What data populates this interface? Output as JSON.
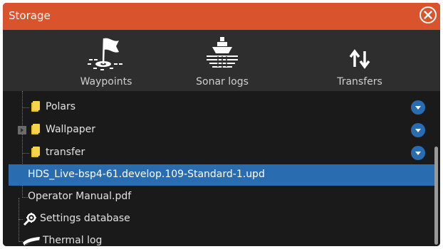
{
  "dialog": {
    "title": "Storage"
  },
  "toolbar": {
    "items": [
      {
        "label": "Waypoints",
        "icon": "waypoint-flag-icon"
      },
      {
        "label": "Sonar logs",
        "icon": "sonar-boat-icon"
      },
      {
        "label": "Transfers",
        "icon": "transfer-arrows-icon"
      }
    ]
  },
  "files": {
    "items": [
      {
        "label": "Polars",
        "type": "folder",
        "expand": false
      },
      {
        "label": "Wallpaper",
        "type": "folder",
        "expand": true
      },
      {
        "label": "transfer",
        "type": "folder",
        "expand": false
      },
      {
        "label": "HDS_Live-bsp4-61.develop.109-Standard-1.upd",
        "type": "file",
        "selected": true
      },
      {
        "label": "Operator Manual.pdf",
        "type": "file"
      },
      {
        "label": "Settings database",
        "type": "settings"
      },
      {
        "label": "Thermal log",
        "type": "log"
      }
    ]
  },
  "colors": {
    "title_bar": "#d9532c",
    "selection": "#2a6cb0",
    "folder": "#f2c21a"
  }
}
